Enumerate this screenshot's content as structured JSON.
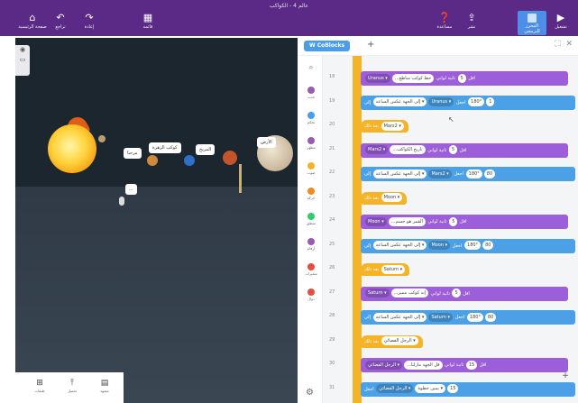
{
  "header": {
    "doc_title": "عالم 4 - الكواكب",
    "left_buttons": [
      {
        "label": "صفحة الرئيسية",
        "icon": "home-icon",
        "glyph": "⌂"
      },
      {
        "label": "تراجع",
        "icon": "undo-icon",
        "glyph": "↶"
      },
      {
        "label": "إعادة",
        "icon": "redo-icon",
        "glyph": "↷"
      },
      {
        "label": "قائمة",
        "icon": "grid-icon",
        "glyph": "▦"
      }
    ],
    "right_buttons": [
      {
        "label": "مساعدة",
        "icon": "help-icon",
        "glyph": "❓"
      },
      {
        "label": "نشر",
        "icon": "share-icon",
        "glyph": "⇪"
      },
      {
        "label": "تشغيل",
        "icon": "play-icon",
        "glyph": "▶"
      }
    ],
    "active_button_label": "المحرر البرمجي",
    "colors": {
      "bar": "#5b2a86",
      "active": "#4d8ee8"
    }
  },
  "stage": {
    "speech_bubbles": [
      "...",
      "مرحبا",
      "كوكب الزهرة",
      "المريخ",
      "الأرض"
    ],
    "bottom_bar": [
      {
        "label": "طبقات",
        "icon": "layers-icon",
        "glyph": "⊞"
      },
      {
        "label": "تحميل",
        "icon": "upload-icon",
        "glyph": "⤒"
      },
      {
        "label": "مشهد",
        "icon": "scene-icon",
        "glyph": "▤"
      }
    ]
  },
  "workspace": {
    "selector_label": "W CoBlocks",
    "add_glyph": "+",
    "categories": [
      {
        "label": "حدث",
        "color": "#9b59b6"
      },
      {
        "label": "تحكم",
        "color": "#4a9de8"
      },
      {
        "label": "مظهر",
        "color": "#9b59b6"
      },
      {
        "label": "صوت",
        "color": "#f5b428"
      },
      {
        "label": "حركة",
        "color": "#f08a24"
      },
      {
        "label": "منطق",
        "color": "#2ecc71"
      },
      {
        "label": "أرقام",
        "color": "#9b59b6"
      },
      {
        "label": "متغيرات",
        "color": "#e74c3c"
      },
      {
        "label": "دوال",
        "color": "#e74c3c"
      }
    ],
    "lines": [
      {
        "no": "18",
        "kind": "say",
        "object": "Uranus",
        "text": "...خط كوكب ساطع",
        "extra": "اقل",
        "duration": "5"
      },
      {
        "no": "19",
        "kind": "move",
        "object": "Uranus",
        "dir": "إلى الجهة عكس الساعة",
        "deg": "180°",
        "n": "1"
      },
      {
        "no": "20",
        "kind": "hat",
        "label": "بعد ذلك",
        "object": "Mars2"
      },
      {
        "no": "21",
        "kind": "say",
        "object": "Mars2",
        "text": "...تاريخ الكواكب",
        "extra": "اقل",
        "duration": "5"
      },
      {
        "no": "22",
        "kind": "move",
        "object": "Mars2",
        "dir": "إلى الجهة عكس الساعة",
        "deg": "180°",
        "n": "80"
      },
      {
        "no": "23",
        "kind": "hat",
        "label": "بعد ذلك",
        "object": "Moon"
      },
      {
        "no": "24",
        "kind": "say",
        "object": "Moon",
        "text": "...القمر هو جسم",
        "extra": "اقل",
        "duration": "5"
      },
      {
        "no": "25",
        "kind": "move",
        "object": "Moon",
        "dir": "إلى الجهة عكس الساعة",
        "deg": "180°",
        "n": "80"
      },
      {
        "no": "26",
        "kind": "hat",
        "label": "بعد ذلك",
        "object": "Saturn"
      },
      {
        "no": "27",
        "kind": "say",
        "object": "Saturn",
        "text": "...إنه كوكب مميز",
        "extra": "اقل",
        "duration": "5"
      },
      {
        "no": "28",
        "kind": "move",
        "object": "Saturn",
        "dir": "إلى الجهة عكس الساعة",
        "deg": "180°",
        "n": "80"
      },
      {
        "no": "29",
        "kind": "hat",
        "label": "بعد ذلك",
        "object": "الرجل الفضائي"
      },
      {
        "no": "30",
        "kind": "say",
        "object": "الرجل الفضائي",
        "text": "...قل الجهة مازلنا",
        "extra": "اقل",
        "duration": "15"
      },
      {
        "no": "31",
        "kind": "move2",
        "object": "الرجل الفضائي",
        "dir": "يمين خطوة",
        "n": "15"
      }
    ],
    "labels": {
      "say_suffix": "لواني",
      "for": "ثانية",
      "to": "إلى",
      "turn": "اجعل"
    }
  }
}
